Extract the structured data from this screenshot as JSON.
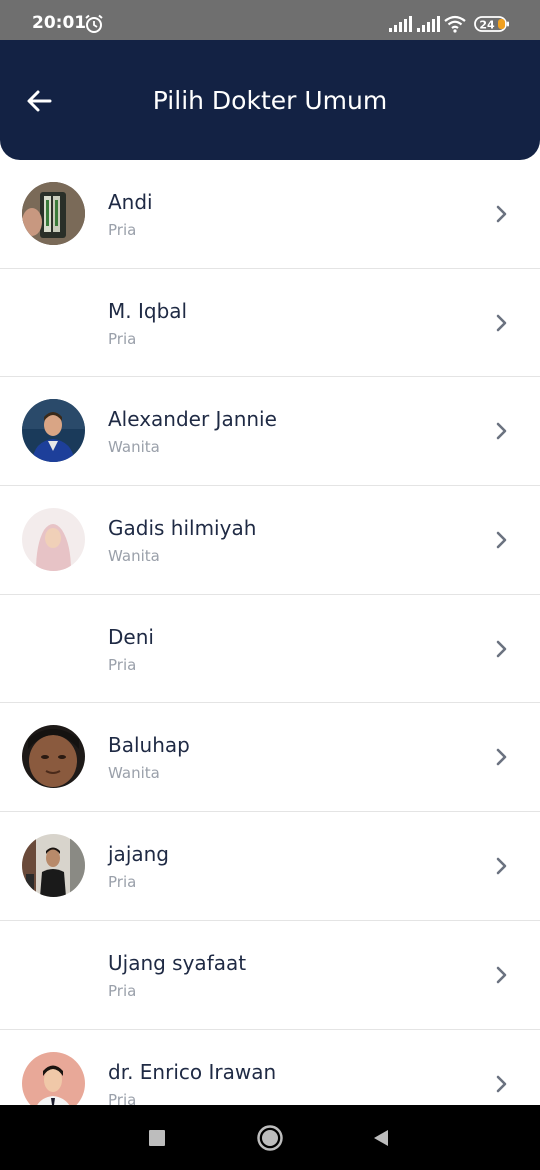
{
  "status_bar": {
    "time": "20:01",
    "battery": "24",
    "icons": [
      "alarm-icon",
      "signal-icon",
      "signal-icon",
      "wifi-icon",
      "battery-icon"
    ]
  },
  "header": {
    "title": "Pilih Dokter Umum",
    "back_icon": "arrow-left-icon",
    "background_color": "#132244"
  },
  "doctors": [
    {
      "name": "Andi",
      "gender": "Pria",
      "has_photo": true
    },
    {
      "name": "M. Iqbal",
      "gender": "Pria",
      "has_photo": false
    },
    {
      "name": "Alexander Jannie",
      "gender": "Wanita",
      "has_photo": true
    },
    {
      "name": "Gadis hilmiyah",
      "gender": "Wanita",
      "has_photo": true
    },
    {
      "name": "Deni",
      "gender": "Pria",
      "has_photo": false
    },
    {
      "name": "Baluhap",
      "gender": "Wanita",
      "has_photo": true
    },
    {
      "name": "jajang",
      "gender": "Pria",
      "has_photo": true
    },
    {
      "name": "Ujang syafaat",
      "gender": "Pria",
      "has_photo": false
    },
    {
      "name": "dr. Enrico Irawan",
      "gender": "Pria",
      "has_photo": true
    }
  ],
  "nav_bar": {
    "buttons": [
      "recents-square-icon",
      "home-circle-icon",
      "back-triangle-icon"
    ]
  }
}
